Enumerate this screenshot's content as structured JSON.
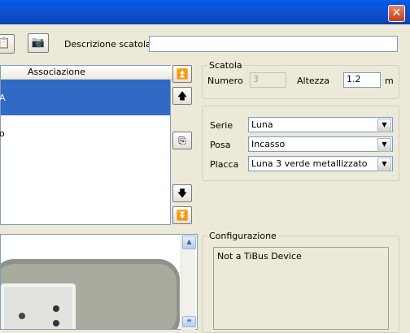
{
  "window": {
    "close_symbol": "✕"
  },
  "toolbar": {
    "paste_icon": "📋",
    "camera_icon": "📷",
    "descrizione_label": "Descrizione scatola",
    "descrizione_value": ""
  },
  "list": {
    "col_associazione": "Associazione",
    "rows": [
      {
        "text": "A",
        "selected": true
      },
      {
        "text": "o",
        "selected": false
      }
    ]
  },
  "arrows": {
    "top": "⏫",
    "up": "🡅",
    "middle": "⎘",
    "down": "🡇",
    "bottom": "⏬"
  },
  "scatola": {
    "title": "Scatola",
    "numero_label": "Numero",
    "numero_value": "3",
    "altezza_label": "Altezza",
    "altezza_value": "1.2",
    "unit": "m"
  },
  "config": {
    "serie_label": "Serie",
    "serie_value": "Luna",
    "posa_label": "Posa",
    "posa_value": "Incasso",
    "placca_label": "Placca",
    "placca_value": "Luna 3 verde metallizzato"
  },
  "configurazione": {
    "title": "Configurazione",
    "text": "Not a TiBus Device"
  },
  "colors": {
    "selection": "#316ac5",
    "titlebar": "#0058e6"
  }
}
